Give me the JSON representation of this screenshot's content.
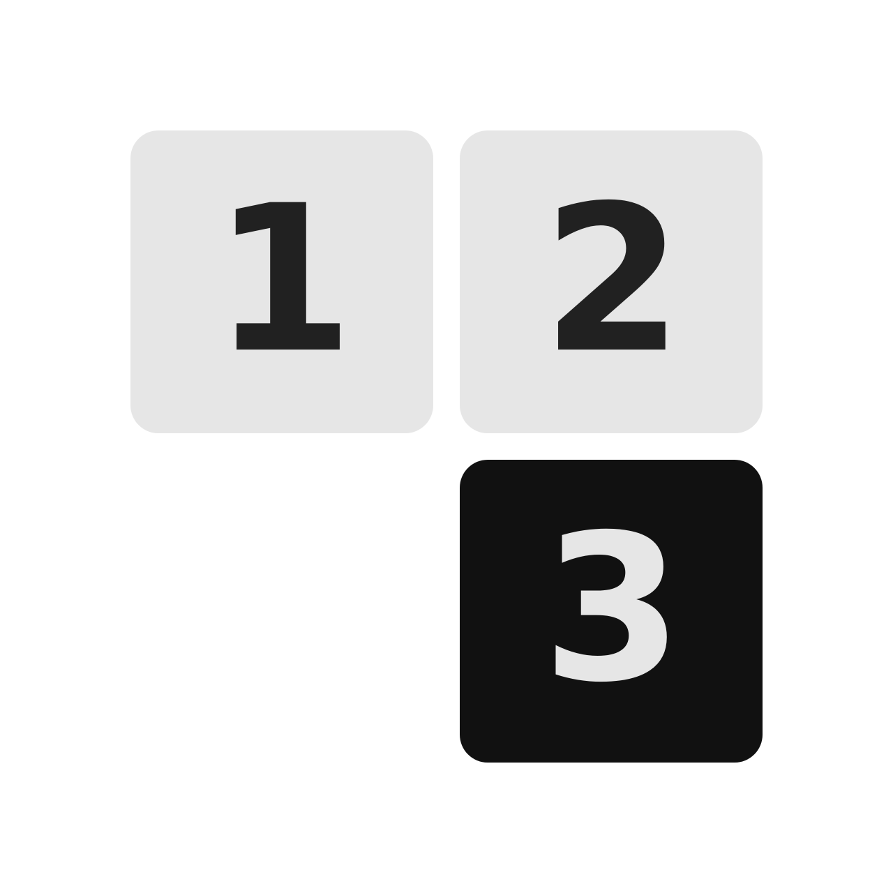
{
  "tiles": [
    {
      "label": "1",
      "background": "#e6e6e6",
      "color": "#212121",
      "state": "inactive"
    },
    {
      "label": "2",
      "background": "#e6e6e6",
      "color": "#212121",
      "state": "inactive"
    },
    {
      "label": "3",
      "background": "#111111",
      "color": "#e6e6e6",
      "state": "active"
    }
  ]
}
